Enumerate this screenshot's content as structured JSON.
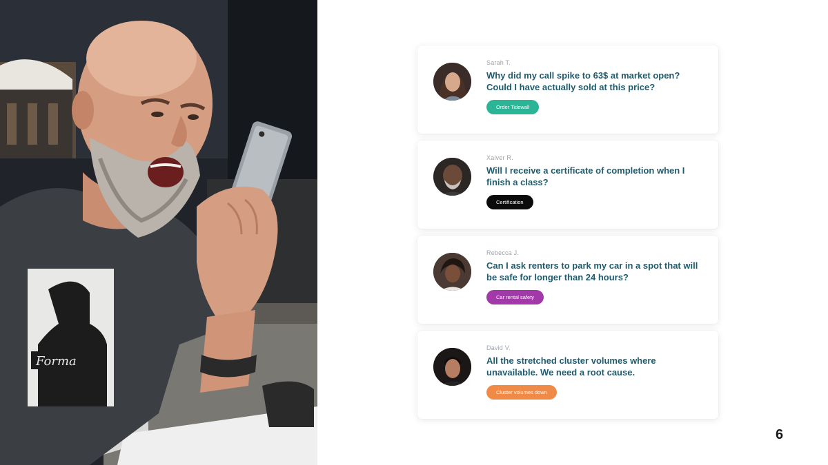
{
  "slide": {
    "page_number": "6"
  },
  "photo": {
    "subject": "man shouting into phone",
    "shirt_text": "Forma"
  },
  "cards": [
    {
      "author": "Sarah T.",
      "question": "Why did my call spike to 63$ at market open? Could I have actually sold at this price?",
      "tag": "Order Tidewall",
      "tag_color": "#2bb596",
      "avatar": "woman-avatar"
    },
    {
      "author": "Xaiver R.",
      "question": "Will I receive a certificate of completion when I finish a class?",
      "tag": "Certification",
      "tag_color": "#0b0b0b",
      "avatar": "older-man-avatar"
    },
    {
      "author": "Rebecca J.",
      "question": "Can I ask renters to park my car in a spot that will be safe for longer than 24 hours?",
      "tag": "Car rental safety",
      "tag_color": "#a13aa8",
      "avatar": "woman-avatar"
    },
    {
      "author": "David V.",
      "question": "All the stretched cluster volumes where unavailable. We need a root cause.",
      "tag": "Cluster volumes down",
      "tag_color": "#f08a47",
      "avatar": "man-avatar"
    }
  ]
}
